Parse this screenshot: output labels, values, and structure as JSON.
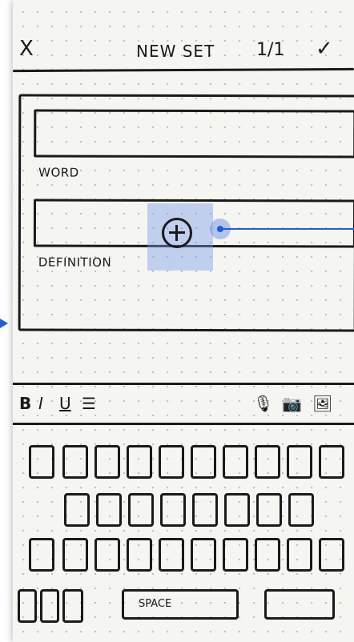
{
  "header": {
    "close": "X",
    "title": "NEW SET",
    "count": "1/1",
    "done": "✓"
  },
  "card": {
    "word_label": "WORD",
    "definition_label": "DEFINITION"
  },
  "toolbar": {
    "bold": "B",
    "italic": "I",
    "underline": "U",
    "list": "☰",
    "mic": "🎙",
    "camera": "📷",
    "image": "🖼"
  },
  "keyboard": {
    "space_label": "SPACE"
  },
  "accent": "#1f5fd6"
}
